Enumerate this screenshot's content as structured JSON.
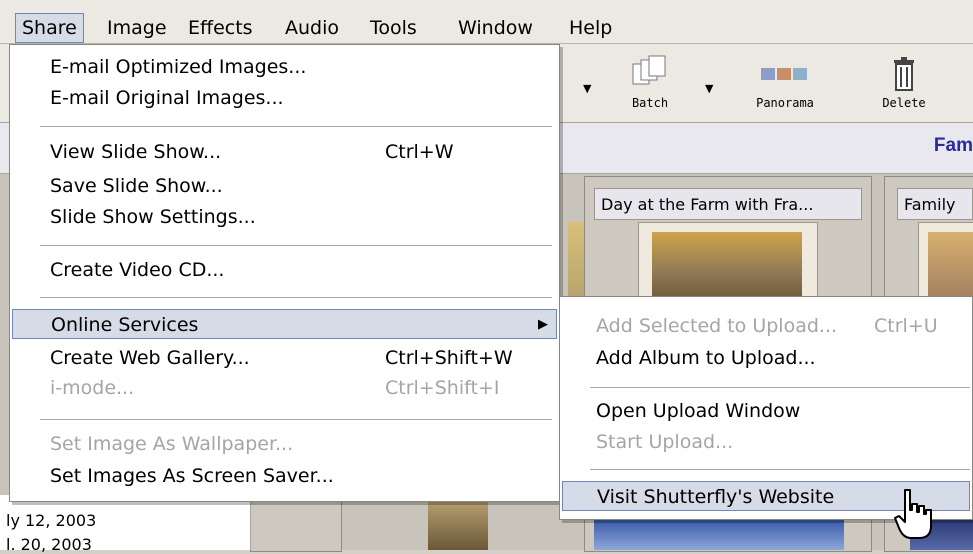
{
  "menubar": {
    "items": [
      "Share",
      "Image",
      "Effects",
      "Audio",
      "Tools",
      "Window",
      "Help"
    ]
  },
  "toolbar": {
    "batch_label": "Batch",
    "panorama_label": "Panorama",
    "delete_label": "Delete"
  },
  "album_title": "Fam",
  "thumbnails": {
    "caption1": "Day at the Farm with Fra...",
    "caption2": "Family"
  },
  "left_list": {
    "line1": "ly 12, 2003",
    "line2": "l. 20, 2003"
  },
  "share_menu": {
    "email_optimized": "E-mail Optimized Images...",
    "email_original": "E-mail Original Images...",
    "view_slide_show": "View Slide Show...",
    "view_slide_show_shortcut": "Ctrl+W",
    "save_slide_show": "Save Slide Show...",
    "slide_show_settings": "Slide Show Settings...",
    "create_video_cd": "Create Video CD...",
    "online_services": "Online Services",
    "create_web_gallery": "Create Web Gallery...",
    "create_web_gallery_shortcut": "Ctrl+Shift+W",
    "imode": "i-mode...",
    "imode_shortcut": "Ctrl+Shift+I",
    "set_wallpaper": "Set Image As Wallpaper...",
    "set_screensaver": "Set Images As Screen Saver..."
  },
  "online_submenu": {
    "add_selected": "Add Selected to Upload...",
    "add_selected_shortcut": "Ctrl+U",
    "add_album": "Add Album to Upload...",
    "open_upload": "Open Upload Window",
    "start_upload": "Start Upload...",
    "visit_shutterfly": "Visit Shutterfly's Website"
  },
  "colors": {
    "highlight_bg": "#d6dbe8",
    "highlight_border": "#6e86b8",
    "disabled_text": "#a5a5a5",
    "album_title": "#2a2a9a"
  }
}
